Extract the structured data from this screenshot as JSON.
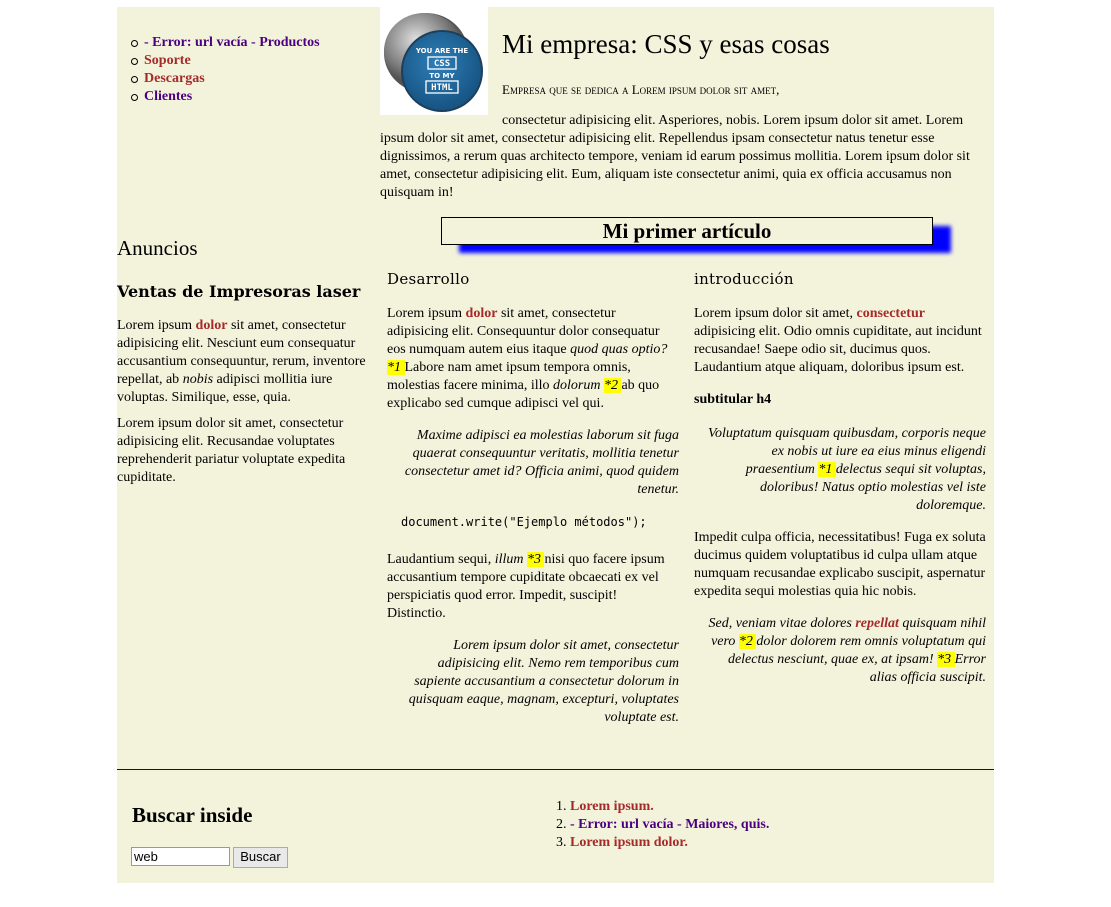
{
  "nav": {
    "items": [
      {
        "label": "- Error: url vacía - Productos",
        "style": "purple"
      },
      {
        "label": "Soporte",
        "style": "red"
      },
      {
        "label": "Descargas",
        "style": "red"
      },
      {
        "label": "Clientes",
        "style": "purple"
      }
    ]
  },
  "logo": {
    "lines": [
      "YOU ARE THE",
      "CSS",
      "TO MY",
      "HTML"
    ]
  },
  "header": {
    "title": "Mi empresa: CSS y esas cosas",
    "subtitle": "Empresa que se dedica a Lorem ipsum dolor sit amet,",
    "intro": "consectetur adipisicing elit. Asperiores, nobis. Lorem ipsum dolor sit amet. Lorem ipsum dolor sit amet, consectetur adipisicing elit. Repellendus ipsam consectetur natus tenetur esse dignissimos, a rerum quas architecto tempore, veniam id earum possimus mollitia. Lorem ipsum dolor sit amet, consectetur adipisicing elit. Eum, aliquam iste consectetur animi, quia ex officia accusamus non quisquam in!"
  },
  "anuncios": {
    "heading": "Anuncios",
    "subheading": "Ventas de Impresoras laser",
    "p1_a": "Lorem ipsum ",
    "p1_link": "dolor",
    "p1_b": " sit amet, consectetur adipisicing elit. Nesciunt eum consequatur accusantium consequuntur, rerum, inventore repellat, ab ",
    "p1_em": "nobis",
    "p1_c": " adipisci mollitia iure voluptas. Similique, esse, quia.",
    "p2": "Lorem ipsum dolor sit amet, consectetur adipisicing elit. Recusandae voluptates reprehenderit pariatur voluptate expedita cupiditate."
  },
  "article": {
    "title": "Mi primer artículo",
    "left": {
      "heading": "Desarrollo",
      "p1_a": "Lorem ipsum ",
      "p1_link": "dolor",
      "p1_b": " sit amet, consectetur adipisicing elit. Consequuntur dolor consequatur eos numquam autem eius itaque ",
      "p1_em": "quod quas optio?",
      "p1_note1": "*1 ",
      "p1_c": "Labore nam amet ipsum tempora omnis, molestias facere minima, illo ",
      "p1_em2": "dolorum ",
      "p1_note2": "*2 ",
      "p1_d": "ab quo explicabo sed cumque adipisci vel qui.",
      "quote1": "Maxime adipisci ea molestias laborum sit fuga quaerat consequuntur veritatis, mollitia tenetur consectetur amet id? Officia animi, quod quidem tenetur.",
      "code": "document.write(\"Ejemplo métodos\");",
      "p2_a": "Laudantium sequi, ",
      "p2_em": "illum ",
      "p2_note3": "*3 ",
      "p2_b": "nisi quo facere ipsum accusantium tempore cupiditate obcaecati ex vel perspiciatis quod error. Impedit, suscipit! Distinctio.",
      "quote2": "Lorem ipsum dolor sit amet, consectetur adipisicing elit. Nemo rem temporibus cum sapiente accusantium a consectetur dolorum in quisquam eaque, magnam, excepturi, voluptates voluptate est."
    },
    "right": {
      "heading": "introducción",
      "p1_a": "Lorem ipsum dolor sit amet, ",
      "p1_link": "consectetur",
      "p1_b": " adipisicing elit. Odio omnis cupiditate, aut incidunt recusandae! Saepe odio sit, ducimus quos. Laudantium atque aliquam, doloribus ipsum est.",
      "subheading": "subtitular h4",
      "quote1_a": "Voluptatum quisquam quibusdam, corporis neque ex nobis ut iure ea eius minus eligendi praesentium ",
      "quote1_note": "*1 ",
      "quote1_b": "delectus sequi sit voluptas, doloribus! Natus optio molestias vel iste doloremque.",
      "p2": "Impedit culpa officia, necessitatibus! Fuga ex soluta ducimus quidem voluptatibus id culpa ullam atque numquam recusandae explicabo suscipit, aspernatur expedita sequi molestias quia hic nobis.",
      "quote2_a": "Sed, veniam vitae dolores ",
      "quote2_link": "repellat",
      "quote2_b": " quisquam nihil vero ",
      "quote2_note2": "*2 ",
      "quote2_c": "dolor dolorem rem omnis voluptatum qui delectus nesciunt, quae ex, at ipsam! ",
      "quote2_note3": "*3 ",
      "quote2_d": "Error alias officia suscipit."
    }
  },
  "footer": {
    "search_title": "Buscar inside",
    "search_value": "web",
    "search_button": "Buscar",
    "links": [
      {
        "label": "Lorem ipsum.",
        "style": "red"
      },
      {
        "label": "- Error: url vacía - Maiores, quis.",
        "style": "purple"
      },
      {
        "label": "Lorem ipsum dolor.",
        "style": "red"
      }
    ]
  }
}
